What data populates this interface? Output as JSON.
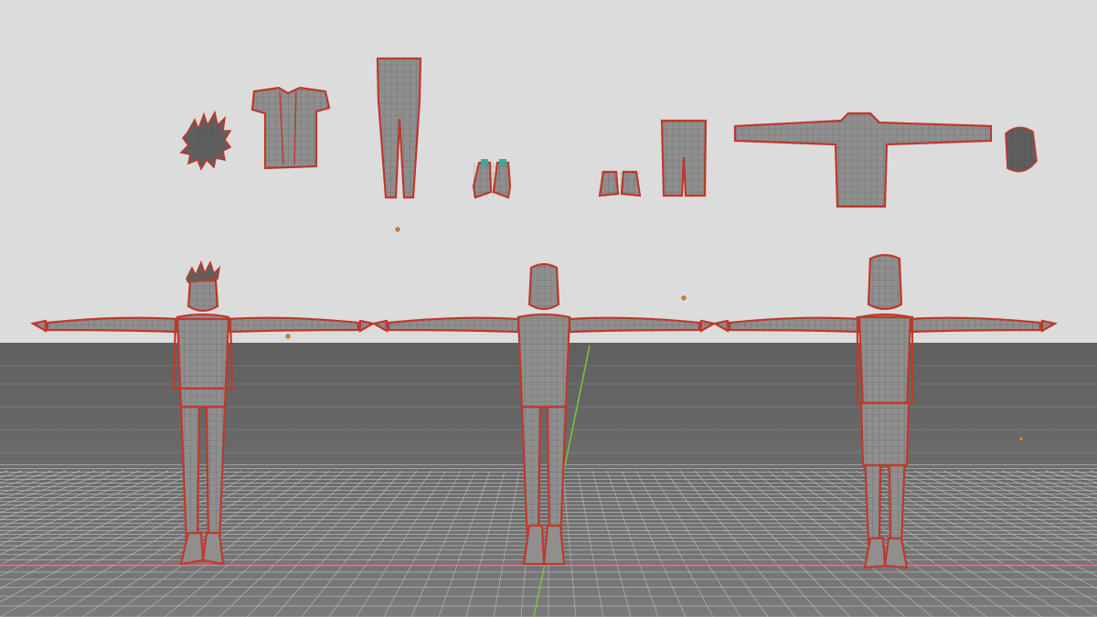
{
  "viewport": {
    "background_color": "#dcdcdc",
    "floor_color": "#6e6e6e",
    "grid_color": "#bdbdbd",
    "mesh_color": "#8f8f8f",
    "wire_outline_color": "#c0392b",
    "x_axis_color": "#d2556a",
    "y_axis_color": "#7fbf3f",
    "origin_marker_color": "#d98a2b"
  },
  "assets": {
    "row_top": [
      {
        "id": "hair-spiky",
        "icon": "spiky-hair-mesh"
      },
      {
        "id": "vest",
        "icon": "vest-mesh"
      },
      {
        "id": "pants-long",
        "icon": "long-pants-mesh"
      },
      {
        "id": "shoes-sneakers",
        "icon": "sneakers-mesh"
      },
      {
        "id": "shoes-low",
        "icon": "low-shoes-mesh"
      },
      {
        "id": "shorts",
        "icon": "shorts-mesh"
      },
      {
        "id": "hoodie",
        "icon": "hoodie-mesh"
      },
      {
        "id": "hair-cap",
        "icon": "cap-hair-mesh"
      }
    ],
    "row_bottom": [
      {
        "id": "character-dressed-vest",
        "icon": "character-tpose-mesh"
      },
      {
        "id": "character-base",
        "icon": "character-tpose-mesh"
      },
      {
        "id": "character-dressed-hoodie",
        "icon": "character-tpose-mesh"
      }
    ]
  }
}
